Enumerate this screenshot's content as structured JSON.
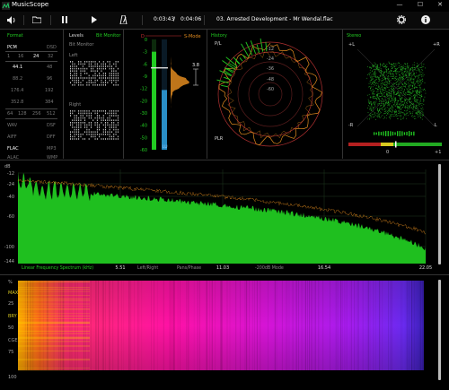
{
  "app": {
    "title": "MusicScope"
  },
  "window": {
    "minimize": "—",
    "maximize": "☐",
    "close": "✕"
  },
  "toolbar": {
    "time_elapsed": "0:03:43",
    "time_separator": "/",
    "time_total": "0:04:06",
    "track": "03. Arrested Development - Mr Wendal.flac"
  },
  "format": {
    "title": "Format",
    "pcm": "PCM",
    "dsd": "DSD",
    "bits": [
      "1",
      "16",
      "24",
      "32"
    ],
    "rates_left": [
      "44.1",
      "88.2",
      "176.4",
      "352.8"
    ],
    "rates_right": [
      "48",
      "96",
      "192",
      "384"
    ],
    "dsd_rates": [
      "64",
      "128",
      "256",
      "512"
    ],
    "codecs_left": [
      "WAV",
      "AIFF",
      "FLAC",
      "ALAC"
    ],
    "codecs_right": [
      "DSF",
      "DFF",
      "MP3",
      "WMP"
    ]
  },
  "levels": {
    "title": "Levels",
    "bit_monitor": "Bit Monitor",
    "sub_title": "Bit Monitor",
    "left": "Left",
    "right": "Right"
  },
  "meter": {
    "mode_left": "D",
    "mode_right": "S-Mode",
    "scale": [
      "0",
      "-3",
      "-6",
      "-9",
      "-12",
      "-20",
      "-30",
      "-40",
      "-50",
      "-60"
    ],
    "channels": [
      "L",
      "LU"
    ],
    "peak_value": "3.8",
    "left_level_db": -3,
    "lu_level_db": -13
  },
  "history": {
    "title": "History",
    "top_label": "P/L",
    "bottom_label": "PLR",
    "rings": [
      "-12",
      "-24",
      "-36",
      "-48",
      "-60"
    ]
  },
  "stereo": {
    "title": "Stereo",
    "plus_l": "+L",
    "plus_r": "+R",
    "minus_r": "-R",
    "minus_l": "-L",
    "zero": "0",
    "plus_one": "+1"
  },
  "spectrum": {
    "db_label": "dB",
    "y_ticks": [
      "-12",
      "-24",
      "-40",
      "-60",
      "-100",
      "-144"
    ],
    "x_ticks": [
      "5.51",
      "11.03",
      "16.54",
      "22.05"
    ],
    "mode_labels": [
      "Linear Frequency Spectrum (kHz)",
      "Left/Right",
      "Pans/Phase",
      "-200dB Mode"
    ]
  },
  "spectrogram": {
    "y_labels": [
      "%",
      "MAX",
      "25",
      "BRY",
      "50",
      "CGE",
      "75",
      "100"
    ]
  },
  "colors": {
    "green": "#22cc22",
    "orange": "#e08a1e",
    "lu_blue": "#2a8ec6"
  }
}
